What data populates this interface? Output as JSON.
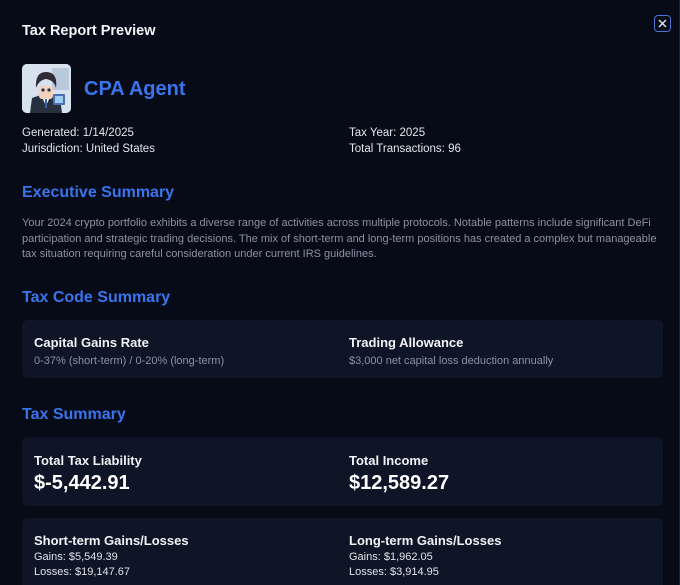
{
  "modal": {
    "title": "Tax Report Preview",
    "close_icon": "close-icon"
  },
  "agent": {
    "name": "CPA Agent",
    "avatar_icon": "agent-avatar"
  },
  "meta": {
    "generated": "Generated: 1/14/2025",
    "jurisdiction": "Jurisdiction: United States",
    "tax_year": "Tax Year: 2025",
    "total_transactions": "Total Transactions: 96"
  },
  "executive_summary": {
    "heading": "Executive Summary",
    "text": "Your 2024 crypto portfolio exhibits a diverse range of activities across multiple protocols. Notable patterns include significant DeFi participation and strategic trading decisions. The mix of short-term and long-term positions has created a complex but manageable tax situation requiring careful consideration under current IRS guidelines."
  },
  "tax_code_summary": {
    "heading": "Tax Code Summary",
    "capital_gains": {
      "label": "Capital Gains Rate",
      "value": "0-37% (short-term) / 0-20% (long-term)"
    },
    "trading_allowance": {
      "label": "Trading Allowance",
      "value": "$3,000 net capital loss deduction annually"
    }
  },
  "tax_summary": {
    "heading": "Tax Summary",
    "total_tax_liability": {
      "label": "Total Tax Liability",
      "value": "$-5,442.91"
    },
    "total_income": {
      "label": "Total Income",
      "value": "$12,589.27"
    },
    "short_term": {
      "label": "Short-term Gains/Losses",
      "gains": "Gains: $5,549.39",
      "losses": "Losses: $19,147.67"
    },
    "long_term": {
      "label": "Long-term Gains/Losses",
      "gains": "Gains: $1,962.05",
      "losses": "Losses: $3,914.95"
    }
  },
  "colors": {
    "accent": "#3a74ec",
    "background": "#060b17",
    "card": "#0d1526"
  }
}
